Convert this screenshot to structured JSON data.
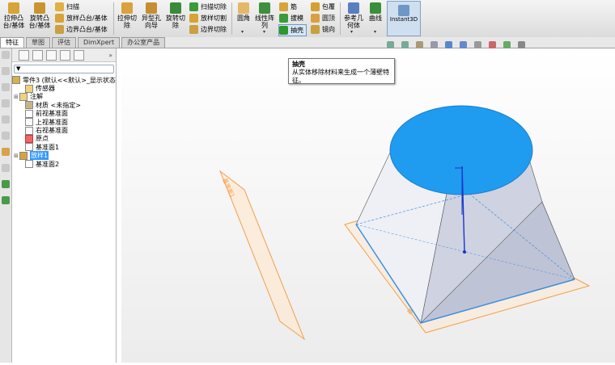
{
  "ribbon": {
    "extrude_boss": "拉伸凸台/基体",
    "revolve_boss": "旋转凸台/基体",
    "sweep": "扫描",
    "loft_boss": "放样凸台/基体",
    "boundary_boss": "边界凸台/基体",
    "extrude_cut": "拉伸切除",
    "hole_wizard": "异型孔向导",
    "revolve_cut": "旋转切除",
    "sweep_cut": "扫描切除",
    "loft_cut": "放样切割",
    "boundary_cut": "边界切除",
    "fillet": "圆角",
    "linear_pattern": "线性阵列",
    "rib": "筋",
    "draft": "拔模",
    "shell": "抽壳",
    "wrap": "包覆",
    "dome": "圆顶",
    "mirror": "镜向",
    "ref_geometry": "参考几何体",
    "curves": "曲线",
    "instant3d": "Instant3D"
  },
  "tabs": [
    "特征",
    "草图",
    "评估",
    "DimXpert",
    "办公室产品"
  ],
  "tooltip": {
    "title": "抽壳",
    "desc": "从实体移除材料来生成一个薄壁特征。"
  },
  "tree": {
    "root": "零件3 (默认<<默认>_显示状态",
    "items": [
      {
        "label": "传感器"
      },
      {
        "label": "注解"
      },
      {
        "label": "材质 <未指定>"
      },
      {
        "label": "前视基准面"
      },
      {
        "label": "上视基准面"
      },
      {
        "label": "右视基准面"
      },
      {
        "label": "原点"
      },
      {
        "label": "基准面1"
      },
      {
        "label": "放样1"
      },
      {
        "label": "基准面2"
      }
    ]
  },
  "viewport": {
    "plane_label_left": "基准面1",
    "plane_label_right": "基准面1"
  },
  "colors": {
    "accent": "#1f9cf0",
    "plane": "#f2a04b"
  }
}
